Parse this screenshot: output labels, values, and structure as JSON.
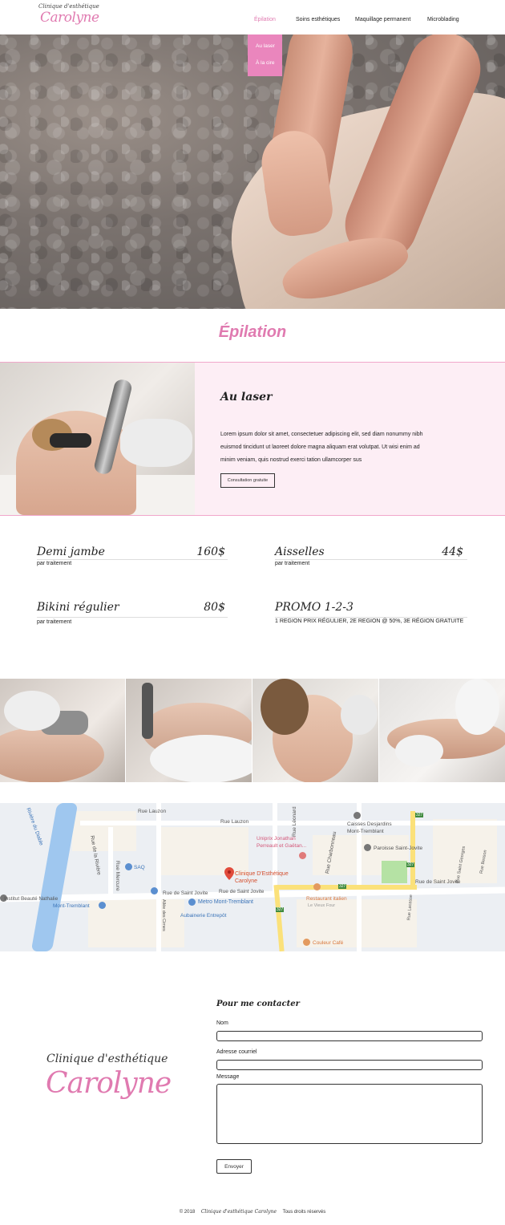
{
  "header": {
    "logo_small": "Clinique d'esthétique",
    "logo_big": "Carolyne",
    "nav": [
      {
        "label": "Épilation",
        "active": true
      },
      {
        "label": "Soins esthétiques",
        "active": false
      },
      {
        "label": "Maquillage permanent",
        "active": false
      },
      {
        "label": "Microblading",
        "active": false
      }
    ],
    "dropdown": [
      "Au laser",
      "À la cire"
    ]
  },
  "page": {
    "title": "Épilation"
  },
  "laser": {
    "title": "Au laser",
    "text": "Lorem ipsum dolor sit amet, consectetuer adipiscing elit, sed diam nonummy nibh euismod tincidunt ut laoreet dolore magna aliquam erat volutpat. Ut wisi enim ad minim veniam, quis nostrud exerci tation ullamcorper sus",
    "button": "Consultation gratuite"
  },
  "prices": [
    {
      "name": "Demi jambe",
      "amount": "160$",
      "sub": "par traitement"
    },
    {
      "name": "Aisselles",
      "amount": "44$",
      "sub": "par traitement"
    },
    {
      "name": "Bikini régulier",
      "amount": "80$",
      "sub": "par traitement"
    },
    {
      "name": "PROMO 1-2-3",
      "amount": "",
      "sub": "1 REGION PRIX RÉGULIER, 2E REGION @ 50%, 3E RÉGION GRATUITE"
    }
  ],
  "map": {
    "labels": {
      "riviere": "Rivière du Diable",
      "rue_lauzon_1": "Rue Lauzon",
      "rue_lauzon_2": "Rue Lauzon",
      "rue_leonard": "Rue Léonard",
      "rue_charbonneau": "Rue Charbonneau",
      "rue_riviere": "Rue de la Rivière",
      "rue_mercure": "Rue Mercure",
      "saq": "SAQ",
      "institut": "Institut Beauté Nathalie",
      "mont_tremblant": "Mont-Tremblant",
      "rue_st_jovite_1": "Rue de Saint Jovite",
      "rue_st_jovite_2": "Rue de Saint Jovite",
      "rue_st_jovite_3": "Rue de Saint Jovite",
      "clinique": "Clinique D'Esthétique Carolyne",
      "uniprix": "Uniprix Jonathan Perreault et Gaëtan...",
      "caisses": "Caisses Desjardins Mont-Tremblant",
      "paroisse": "Paroisse Saint-Jovite",
      "metro": "Metro Mont-Tremblant",
      "aubainerie": "Aubainerie Entrepôt",
      "restaurant": "Restaurant italien",
      "vieux_four": "Le Vieux Four",
      "couleur_cafe": "Couleur Café",
      "allee_cimes": "Allée des Cimes",
      "rue_lacasse": "Rue Lacasse",
      "rue_st_georges": "Rue Saint Georges",
      "rue_besson": "Rue Besson",
      "route_327a": "327",
      "route_327b": "327",
      "route_327c": "327",
      "route_327d": "327"
    }
  },
  "contact": {
    "logo_small": "Clinique d'esthétique",
    "logo_big": "Carolyne",
    "title": "Pour me contacter",
    "name_label": "Nom",
    "email_label": "Adresse courriel",
    "message_label": "Message",
    "send": "Envoyer"
  },
  "footer": {
    "year": "© 2018",
    "brand": "Clinique d'esthétique Carolyne",
    "rights": "Tous droits réservés"
  },
  "colors": {
    "accent": "#e07ab0",
    "dropdown_bg": "#ea86bd",
    "panel_bg": "#fdeef5"
  }
}
